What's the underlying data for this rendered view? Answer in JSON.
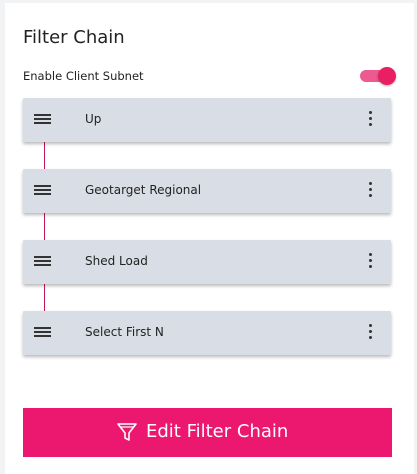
{
  "panel": {
    "title": "Filter Chain"
  },
  "client_subnet": {
    "label": "Enable Client Subnet",
    "enabled": true
  },
  "chain": {
    "items": [
      {
        "label": "Up"
      },
      {
        "label": "Geotarget Regional"
      },
      {
        "label": "Shed Load"
      },
      {
        "label": "Select First N"
      }
    ]
  },
  "edit_button": {
    "label": "Edit Filter Chain",
    "icon": "filter-icon"
  },
  "colors": {
    "accent": "#ec176e",
    "item_bg": "#d9dee6",
    "connector": "#c2185b"
  }
}
